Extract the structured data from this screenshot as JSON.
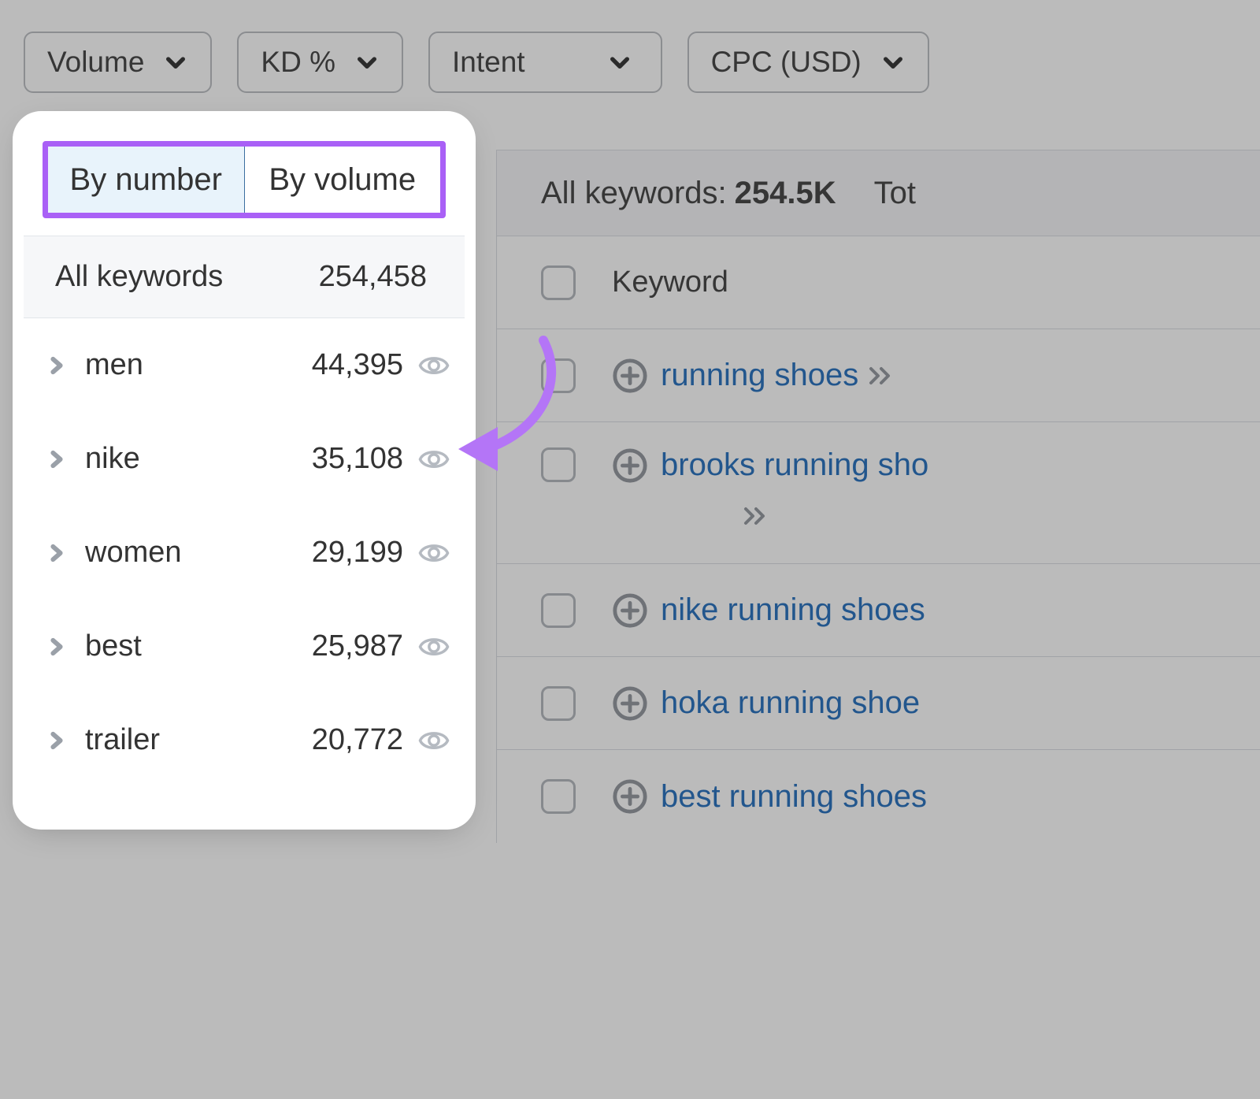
{
  "filters": {
    "volume": "Volume",
    "kd": "KD %",
    "intent": "Intent",
    "cpc": "CPC (USD)"
  },
  "summary": {
    "label": "All keywords:",
    "count": "254.5K",
    "total_label": "Tot"
  },
  "table": {
    "header": "Keyword",
    "rows": [
      {
        "text": "running shoes",
        "wrap": false
      },
      {
        "text": "brooks running sho",
        "wrap": true
      },
      {
        "text": "nike running shoes",
        "wrap": false
      },
      {
        "text": "hoka running shoe",
        "wrap": false
      },
      {
        "text": "best running shoes",
        "wrap": false
      }
    ]
  },
  "panel": {
    "tabs": {
      "by_number": "By number",
      "by_volume": "By volume"
    },
    "head": {
      "label": "All keywords",
      "count": "254,458"
    },
    "groups": [
      {
        "label": "men",
        "count": "44,395"
      },
      {
        "label": "nike",
        "count": "35,108"
      },
      {
        "label": "women",
        "count": "29,199"
      },
      {
        "label": "best",
        "count": "25,987"
      },
      {
        "label": "trailer",
        "count": "20,772"
      }
    ]
  }
}
